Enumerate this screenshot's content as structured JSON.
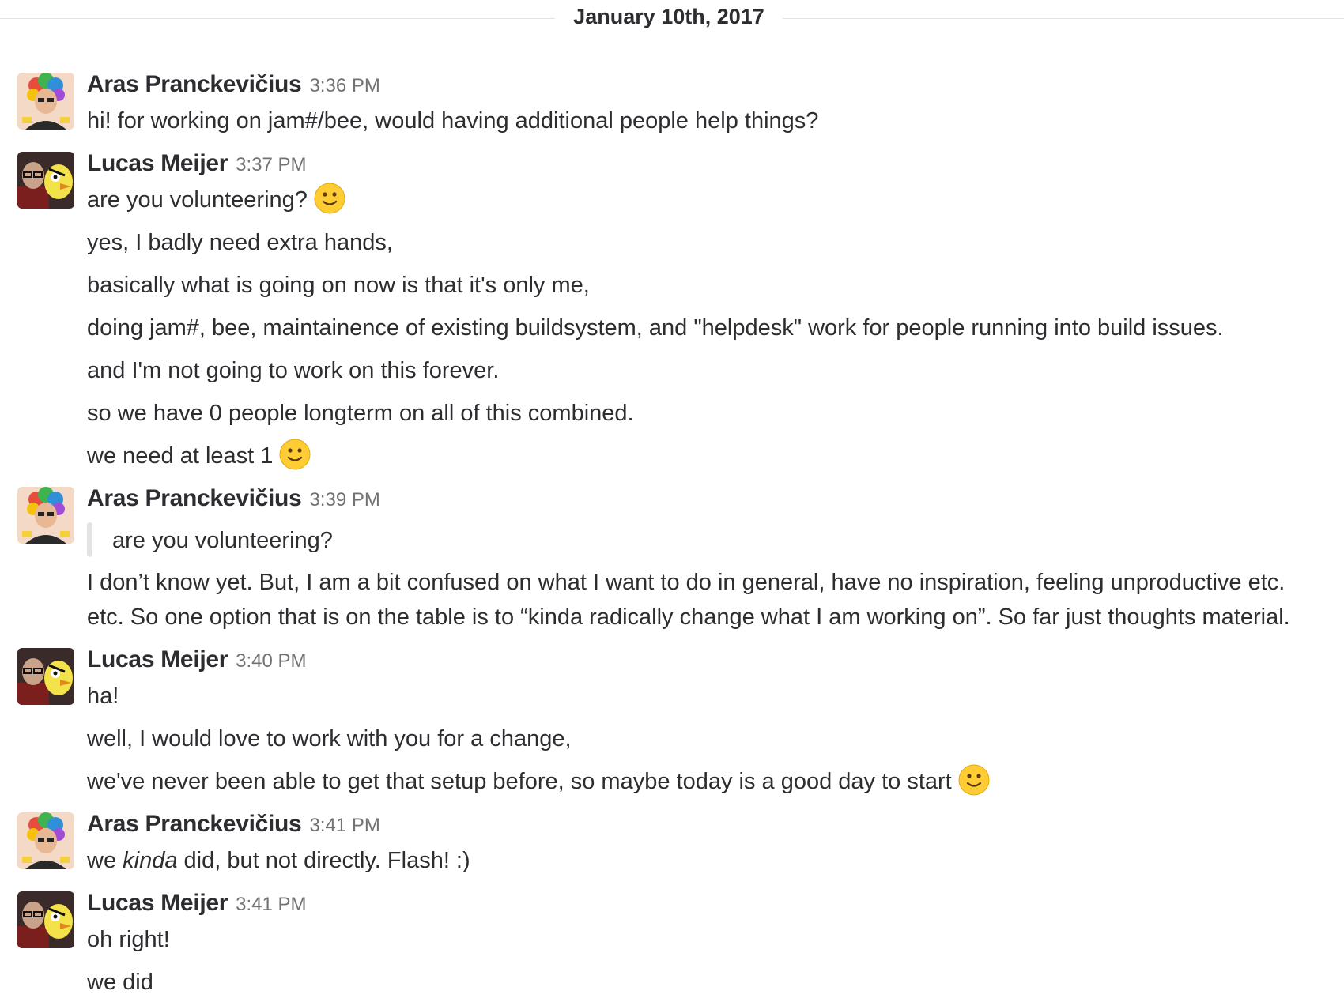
{
  "day_divider": {
    "label": "January 10th, 2017"
  },
  "users": {
    "aras": {
      "name": "Aras Pranckevičius"
    },
    "lucas": {
      "name": "Lucas Meijer"
    }
  },
  "messages": [
    {
      "author": "Aras Pranckevičius",
      "time": "3:36 PM",
      "lines": [
        "hi! for working on jam#/bee, would having additional people help things?"
      ]
    },
    {
      "author": "Lucas Meijer",
      "time": "3:37 PM",
      "lines": [
        "are you volunteering?",
        "yes, I badly need extra hands,",
        "basically what is going on now is that it's only me,",
        "doing jam#,  bee,  maintainence of existing buildsystem,  and \"helpdesk\" work for people running into build issues.",
        "and I'm not going to work on this forever.",
        "so we have 0 people longterm on all of this combined.",
        "we need at least 1"
      ]
    },
    {
      "author": "Aras Pranckevičius",
      "time": "3:39 PM",
      "quote": "are you volunteering?",
      "lines": [
        "I don’t know yet. But, I am a bit confused on what I want to do in general, have no inspiration, feeling unproductive etc. etc. So one option that is on the table is to “kinda radically change what I am working on”. So far just thoughts material."
      ]
    },
    {
      "author": "Lucas Meijer",
      "time": "3:40 PM",
      "lines": [
        "ha!",
        "well, I would love to work with you for a change,",
        "we've never been able to get that setup before, so maybe today is a good day to start"
      ]
    },
    {
      "author": "Aras Pranckevičius",
      "time": "3:41 PM",
      "lines": [
        "we",
        "kinda",
        "did, but not directly. Flash! :)"
      ]
    },
    {
      "author": "Lucas Meijer",
      "time": "3:41 PM",
      "lines": [
        "oh right!",
        "we did"
      ]
    }
  ],
  "emoji": {
    "name": "slightly-smiling-face-icon",
    "color": "#ffcc33"
  }
}
